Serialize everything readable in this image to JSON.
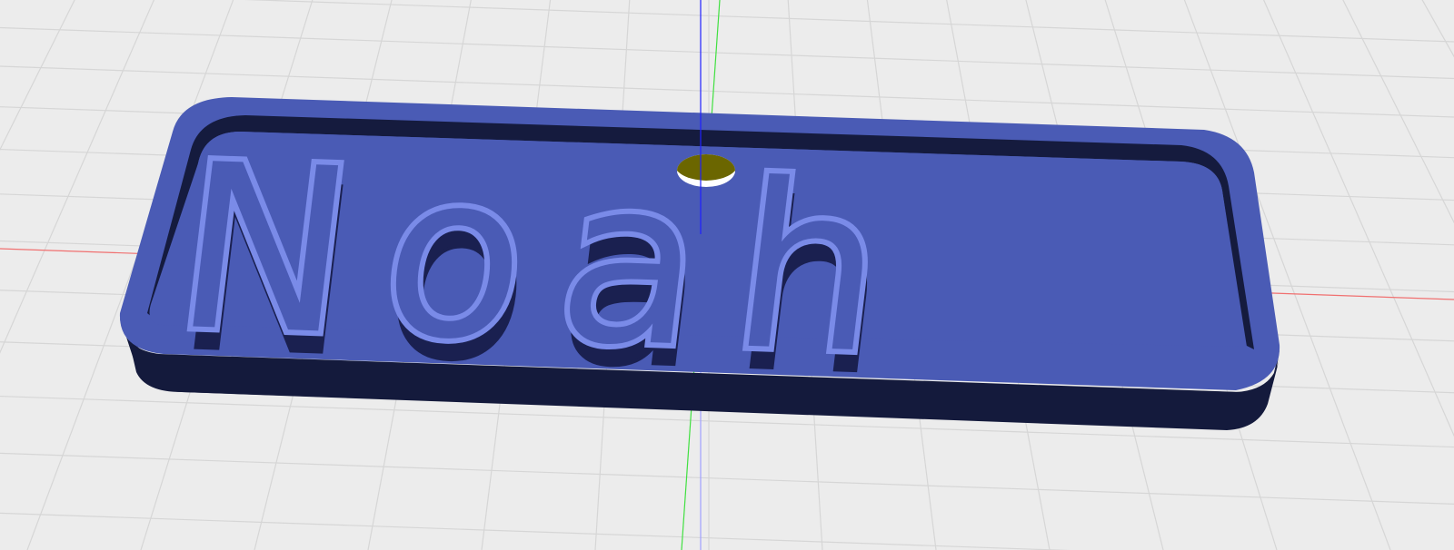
{
  "viewport": {
    "background_color": "#ececec",
    "grid_color": "#d6d6d6",
    "axis_colors": {
      "x": "#f07070",
      "y": "#40e040",
      "z": "#2020ff"
    }
  },
  "model": {
    "name_text": "Noah",
    "plate_top_color": "#4a5bb5",
    "plate_side_color": "#141a3c",
    "text_color": "#7a8be8",
    "hole_inner_color": "#6b6600"
  }
}
